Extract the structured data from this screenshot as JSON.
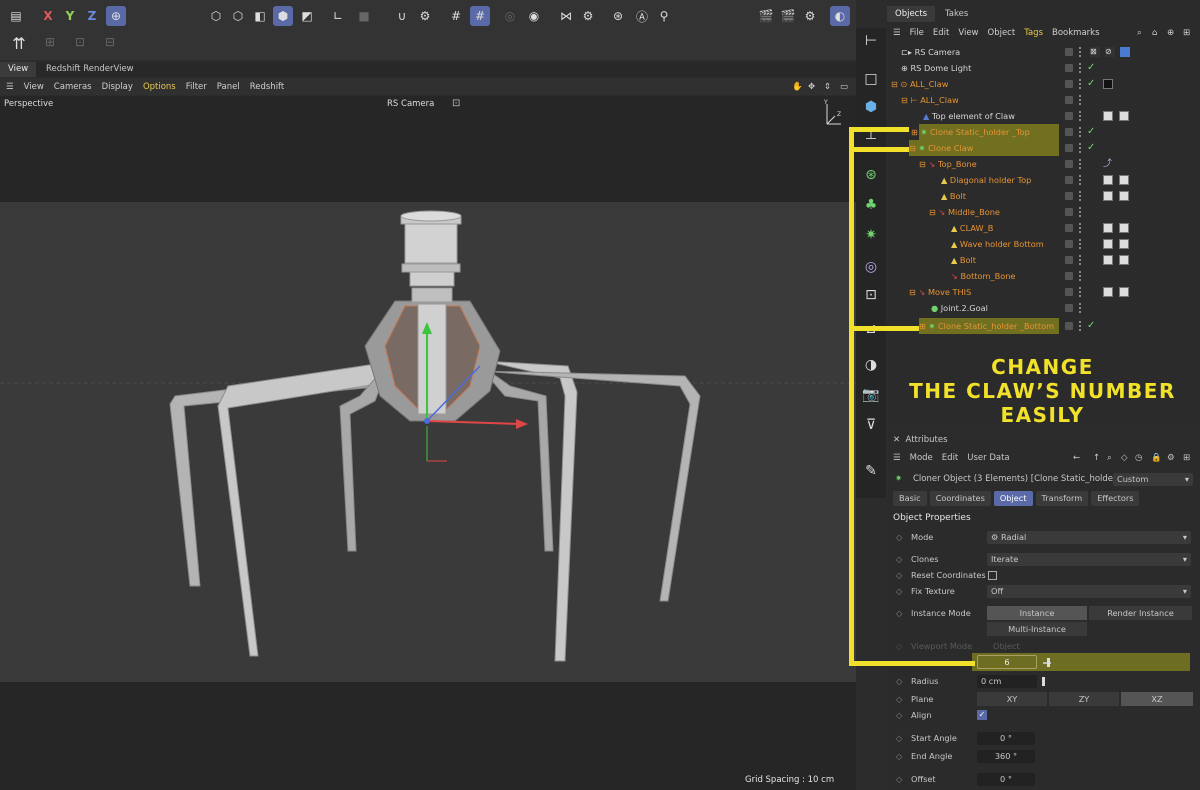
{
  "toolbar": {
    "axes": [
      "X",
      "Y",
      "Z"
    ]
  },
  "view_tabs": [
    "View",
    "Redshift RenderView"
  ],
  "view_menu": [
    "View",
    "Cameras",
    "Display",
    "Options",
    "Filter",
    "Panel",
    "Redshift"
  ],
  "viewport": {
    "label": "Perspective",
    "camera": "RS Camera",
    "grid_spacing": "Grid Spacing : 10 cm"
  },
  "objects_panel": {
    "tabs": [
      "Objects",
      "Takes"
    ],
    "menu": [
      "File",
      "Edit",
      "View",
      "Object",
      "Tags",
      "Bookmarks"
    ],
    "items": [
      {
        "label": "RS Camera"
      },
      {
        "label": "RS Dome Light"
      },
      {
        "label": "ALL_Claw"
      },
      {
        "label": "ALL_Claw"
      },
      {
        "label": "Top element of Claw"
      },
      {
        "label": "Clone Static_holder _Top"
      },
      {
        "label": "Clone Claw"
      },
      {
        "label": "Top_Bone"
      },
      {
        "label": "Diagonal  holder Top"
      },
      {
        "label": "Bolt"
      },
      {
        "label": "Middle_Bone"
      },
      {
        "label": "CLAW_B"
      },
      {
        "label": "Wave holder Bottom"
      },
      {
        "label": "Bolt"
      },
      {
        "label": "Bottom_Bone"
      },
      {
        "label": "Move THIS"
      },
      {
        "label": "Joint.2.Goal"
      },
      {
        "label": "Clone Static_holder _Bottom"
      }
    ]
  },
  "annotation": {
    "line1": "CHANGE",
    "line2": "THE CLAW’S NUMBER",
    "line3": "EASILY"
  },
  "attributes": {
    "title": "Attributes",
    "menu": [
      "Mode",
      "Edit",
      "User Data"
    ],
    "object_line": "Cloner Object (3 Elements) [Clone Static_holder ...",
    "preset": "Custom",
    "tabs": [
      "Basic",
      "Coordinates",
      "Object",
      "Transform",
      "Effectors"
    ],
    "section": "Object Properties",
    "mode_label": "Mode",
    "mode_value": "Radial",
    "clones_label": "Clones",
    "clones_value": "Iterate",
    "reset_label": "Reset Coordinates",
    "fix_label": "Fix Texture",
    "fix_value": "Off",
    "instance_label": "Instance Mode",
    "instance_opts": [
      "Instance",
      "Render Instance",
      "Multi-Instance"
    ],
    "viewport_mode_label": "Viewport Mode",
    "viewport_mode_value": "Object",
    "count_value": "6",
    "radius_label": "Radius",
    "radius_value": "0 cm",
    "plane_label": "Plane",
    "plane_opts": [
      "XY",
      "ZY",
      "XZ"
    ],
    "align_label": "Align",
    "start_label": "Start Angle",
    "start_value": "0 °",
    "end_label": "End Angle",
    "end_value": "360 °",
    "offset_label": "Offset",
    "offset_value": "0 °"
  }
}
